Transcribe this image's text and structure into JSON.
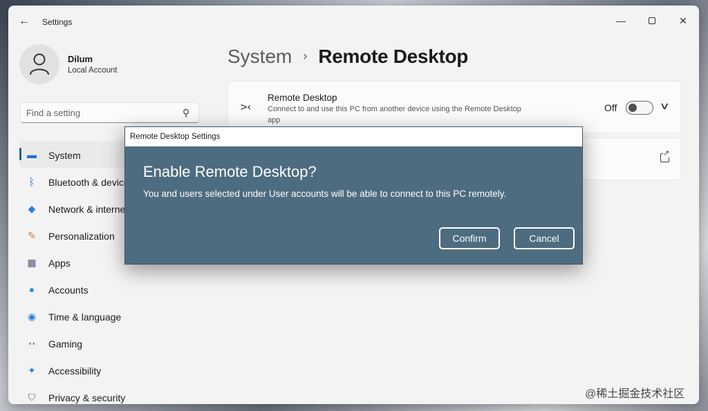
{
  "window": {
    "back_glyph": "←",
    "title": "Settings",
    "controls": {
      "minimize": "—",
      "close": "✕"
    }
  },
  "profile": {
    "name": "Dilum",
    "account_type": "Local Account"
  },
  "search": {
    "placeholder": "Find a setting",
    "value": ""
  },
  "sidebar": {
    "items": [
      {
        "label": "System",
        "icon": "monitor-icon",
        "glyph": "▬",
        "color": "#1f6fd1"
      },
      {
        "label": "Bluetooth & devices",
        "icon": "bluetooth-icon",
        "glyph": "ᛒ",
        "color": "#1f6fd1"
      },
      {
        "label": "Network & internet",
        "icon": "wifi-icon",
        "glyph": "◆",
        "color": "#2d7fd8"
      },
      {
        "label": "Personalization",
        "icon": "brush-icon",
        "glyph": "✎",
        "color": "#c77b3a"
      },
      {
        "label": "Apps",
        "icon": "apps-icon",
        "glyph": "▦",
        "color": "#4a5a6a"
      },
      {
        "label": "Accounts",
        "icon": "person-icon",
        "glyph": "●",
        "color": "#2d8fd8"
      },
      {
        "label": "Time & language",
        "icon": "globe-icon",
        "glyph": "◉",
        "color": "#2d7fd8"
      },
      {
        "label": "Gaming",
        "icon": "controller-icon",
        "glyph": "◖◗",
        "color": "#6a6a6a"
      },
      {
        "label": "Accessibility",
        "icon": "accessibility-icon",
        "glyph": "✦",
        "color": "#2d7fd8"
      },
      {
        "label": "Privacy & security",
        "icon": "shield-icon",
        "glyph": "⛉",
        "color": "#6a6a6a"
      }
    ]
  },
  "breadcrumb": {
    "parent": "System",
    "separator": "›",
    "current": "Remote Desktop"
  },
  "remote_desktop_card": {
    "icon_glyph": ">‹",
    "title": "Remote Desktop",
    "description": "Connect to and use this PC from another device using the Remote Desktop app",
    "toggle_label": "Off",
    "toggle_on": false,
    "chevron": "∨"
  },
  "dialog": {
    "title": "Remote Desktop Settings",
    "heading": "Enable Remote Desktop?",
    "message": "You and users selected under User accounts will be able to connect to this PC remotely.",
    "confirm_label": "Confirm",
    "cancel_label": "Cancel",
    "background_color": "#4e6c7f"
  },
  "watermark": "@稀土掘金技术社区"
}
